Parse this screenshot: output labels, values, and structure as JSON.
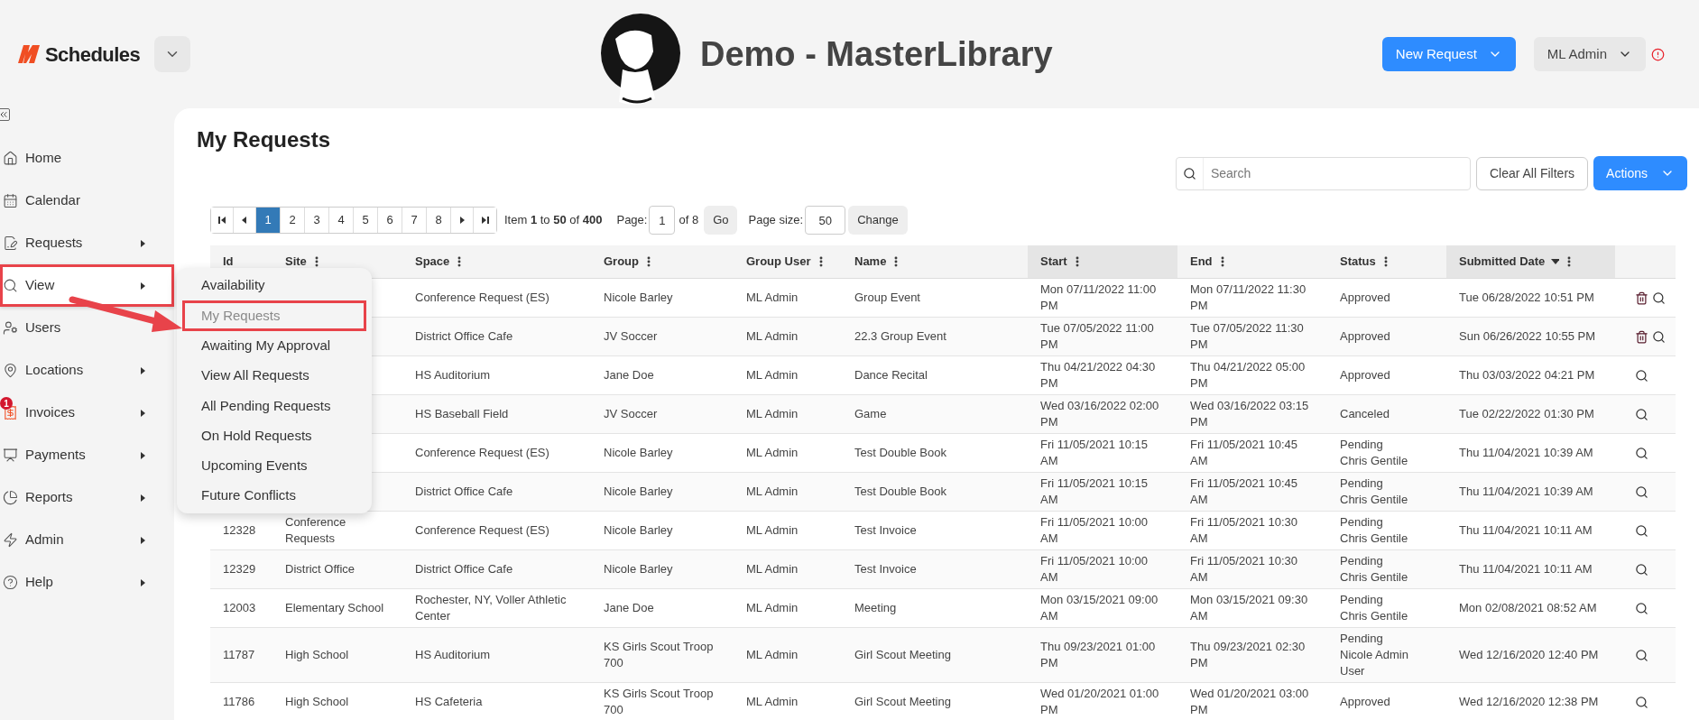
{
  "header": {
    "app_name": "Schedules",
    "title": "Demo - MasterLibrary",
    "new_request": "New Request",
    "user": "ML Admin",
    "alert": true
  },
  "sidebar": {
    "items": [
      {
        "label": "Home",
        "has_submenu": false,
        "selected": false,
        "annotated": false
      },
      {
        "label": "Calendar",
        "has_submenu": false,
        "selected": false,
        "annotated": false
      },
      {
        "label": "Requests",
        "has_submenu": true,
        "selected": false,
        "annotated": false
      },
      {
        "label": "View",
        "has_submenu": true,
        "selected": true,
        "annotated": true
      },
      {
        "label": "Users",
        "has_submenu": false,
        "selected": false,
        "annotated": false
      },
      {
        "label": "Locations",
        "has_submenu": true,
        "selected": false,
        "annotated": false
      },
      {
        "label": "Invoices",
        "has_submenu": true,
        "selected": false,
        "annotated": false,
        "badge": "1"
      },
      {
        "label": "Payments",
        "has_submenu": true,
        "selected": false,
        "annotated": false
      },
      {
        "label": "Reports",
        "has_submenu": true,
        "selected": false,
        "annotated": false
      },
      {
        "label": "Admin",
        "has_submenu": true,
        "selected": false,
        "annotated": false
      },
      {
        "label": "Help",
        "has_submenu": true,
        "selected": false,
        "annotated": false
      }
    ]
  },
  "view_menu": {
    "arrow": true,
    "items": [
      {
        "label": "Availability",
        "disabled": false,
        "annotated": false
      },
      {
        "label": "My Requests",
        "disabled": true,
        "annotated": true
      },
      {
        "label": "Awaiting My Approval",
        "disabled": false,
        "annotated": false
      },
      {
        "label": "View All Requests",
        "disabled": false,
        "annotated": false
      },
      {
        "label": "All Pending Requests",
        "disabled": false,
        "annotated": false
      },
      {
        "label": "On Hold Requests",
        "disabled": false,
        "annotated": false
      },
      {
        "label": "Upcoming Events",
        "disabled": false,
        "annotated": false
      },
      {
        "label": "Future Conflicts",
        "disabled": false,
        "annotated": false
      }
    ]
  },
  "page": {
    "title": "My Requests",
    "search": {
      "placeholder": "Search"
    },
    "clear_filters": "Clear All Filters",
    "actions": "Actions"
  },
  "pagination": {
    "pages": [
      {
        "label": "1",
        "selected": true
      },
      {
        "label": "2",
        "selected": false
      },
      {
        "label": "3",
        "selected": false
      },
      {
        "label": "4",
        "selected": false
      },
      {
        "label": "5",
        "selected": false
      },
      {
        "label": "6",
        "selected": false
      },
      {
        "label": "7",
        "selected": false
      },
      {
        "label": "8",
        "selected": false
      }
    ],
    "summary": "Item **1** to **50** of **400**",
    "page_label": "Page:",
    "page_value": "1",
    "page_of": "of 8",
    "go": "Go",
    "size_label": "Page size:",
    "size_value": "50",
    "change": "Change"
  },
  "table": {
    "columns": [
      {
        "label": "Id",
        "menu": false,
        "highlighted": false,
        "sorted": false
      },
      {
        "label": "Site",
        "menu": true,
        "highlighted": false,
        "sorted": false
      },
      {
        "label": "Space",
        "menu": true,
        "highlighted": false,
        "sorted": false
      },
      {
        "label": "Group",
        "menu": true,
        "highlighted": false,
        "sorted": false
      },
      {
        "label": "Group User",
        "menu": true,
        "highlighted": false,
        "sorted": false
      },
      {
        "label": "Name",
        "menu": true,
        "highlighted": false,
        "sorted": false
      },
      {
        "label": "Start",
        "menu": true,
        "highlighted": true,
        "sorted": false
      },
      {
        "label": "End",
        "menu": true,
        "highlighted": false,
        "sorted": false
      },
      {
        "label": "Status",
        "menu": true,
        "highlighted": false,
        "sorted": false
      },
      {
        "label": "Submitted Date",
        "menu": true,
        "highlighted": true,
        "sorted": true
      }
    ],
    "rows": [
      {
        "space": "Conference Request (ES)",
        "group": "Nicole Barley",
        "group_user": "ML Admin",
        "name": "Group Event",
        "start": "Mon 07/11/2022 11:00 PM",
        "end": "Mon 07/11/2022 11:30 PM",
        "status": "Approved",
        "submitted": "Tue 06/28/2022 10:51 PM",
        "deletable": true
      },
      {
        "space": "District Office Cafe",
        "group": "JV Soccer",
        "group_user": "ML Admin",
        "name": "22.3 Group Event",
        "start": "Tue 07/05/2022 11:00 PM",
        "end": "Tue 07/05/2022 11:30 PM",
        "status": "Approved",
        "submitted": "Sun 06/26/2022 10:55 PM",
        "deletable": true
      },
      {
        "space": "HS Auditorium",
        "group": "Jane Doe",
        "group_user": "ML Admin",
        "name": "Dance Recital",
        "start": "Thu 04/21/2022 04:30 PM",
        "end": "Thu 04/21/2022 05:00 PM",
        "status": "Approved",
        "submitted": "Thu 03/03/2022 04:21 PM",
        "deletable": false
      },
      {
        "space": "HS Baseball Field",
        "group": "JV Soccer",
        "group_user": "ML Admin",
        "name": "Game",
        "start": "Wed 03/16/2022 02:00 PM",
        "end": "Wed 03/16/2022 03:15 PM",
        "status": "Canceled",
        "submitted": "Tue 02/22/2022 01:30 PM",
        "deletable": false
      },
      {
        "space": "Conference Request (ES)",
        "group": "Nicole Barley",
        "group_user": "ML Admin",
        "name": "Test Double Book",
        "start": "Fri 11/05/2021 10:15 AM",
        "end": "Fri 11/05/2021 10:45 AM",
        "status": "Pending",
        "approver": "Chris Gentile",
        "submitted": "Thu 11/04/2021 10:39 AM",
        "deletable": false
      },
      {
        "space": "District Office Cafe",
        "group": "Nicole Barley",
        "group_user": "ML Admin",
        "name": "Test Double Book",
        "start": "Fri 11/05/2021 10:15 AM",
        "end": "Fri 11/05/2021 10:45 AM",
        "status": "Pending",
        "approver": "Chris Gentile",
        "submitted": "Thu 11/04/2021 10:39 AM",
        "deletable": false
      },
      {
        "id": "12328",
        "site": "Conference Requests",
        "space": "Conference Request (ES)",
        "group": "Nicole Barley",
        "group_user": "ML Admin",
        "name": "Test Invoice",
        "start": "Fri 11/05/2021 10:00 AM",
        "end": "Fri 11/05/2021 10:30 AM",
        "status": "Pending",
        "approver": "Chris Gentile",
        "submitted": "Thu 11/04/2021 10:11 AM",
        "deletable": false
      },
      {
        "id": "12329",
        "site": "District Office",
        "space": "District Office Cafe",
        "group": "Nicole Barley",
        "group_user": "ML Admin",
        "name": "Test Invoice",
        "start": "Fri 11/05/2021 10:00 AM",
        "end": "Fri 11/05/2021 10:30 AM",
        "status": "Pending",
        "approver": "Chris Gentile",
        "submitted": "Thu 11/04/2021 10:11 AM",
        "deletable": false
      },
      {
        "id": "12003",
        "site": "Elementary School",
        "space": "Rochester, NY, Voller Athletic Center",
        "group": "Jane Doe",
        "group_user": "ML Admin",
        "name": "Meeting",
        "start": "Mon 03/15/2021 09:00 AM",
        "end": "Mon 03/15/2021 09:30 AM",
        "status": "Pending",
        "approver": "Chris Gentile",
        "submitted": "Mon 02/08/2021 08:52 AM",
        "deletable": false
      },
      {
        "id": "11787",
        "site": "High School",
        "space": "HS Auditorium",
        "group": "KS Girls Scout Troop 700",
        "group_user": "ML Admin",
        "name": "Girl Scout Meeting",
        "start": "Thu 09/23/2021 01:00 PM",
        "end": "Thu 09/23/2021 02:30 PM",
        "status": "Pending",
        "approver": "Nicole Admin User",
        "submitted": "Wed 12/16/2020 12:40 PM",
        "deletable": false
      },
      {
        "id": "11786",
        "site": "High School",
        "space": "HS Cafeteria",
        "group": "KS Girls Scout Troop 700",
        "group_user": "ML Admin",
        "name": "Girl Scout Meeting",
        "start": "Wed 01/20/2021 01:00 PM",
        "end": "Wed 01/20/2021 03:00 PM",
        "status": "Approved",
        "submitted": "Wed 12/16/2020 12:38 PM",
        "deletable": false
      }
    ]
  }
}
